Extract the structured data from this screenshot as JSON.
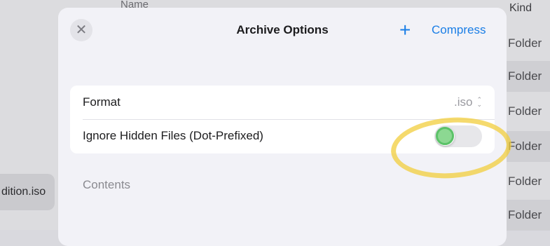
{
  "background": {
    "column_name": "Name",
    "column_kind": "Kind",
    "kind_values": [
      "Folder",
      "Folder",
      "Folder",
      "Folder",
      "Folder",
      "Folder"
    ],
    "selected_file": "dition.iso"
  },
  "sheet": {
    "title": "Archive Options",
    "close_icon": "close-icon",
    "plus_icon": "plus-icon",
    "compress_label": "Compress",
    "accent_color": "#1a7ee6"
  },
  "settings": {
    "format_label": "Format",
    "format_value": ".iso",
    "ignore_hidden_label": "Ignore Hidden Files (Dot-Prefixed)",
    "ignore_hidden_on": false
  },
  "section": {
    "contents_header": "Contents"
  },
  "annotation": {
    "highlight_color": "#f2cd3c",
    "touch_color": "#3fb84e"
  }
}
